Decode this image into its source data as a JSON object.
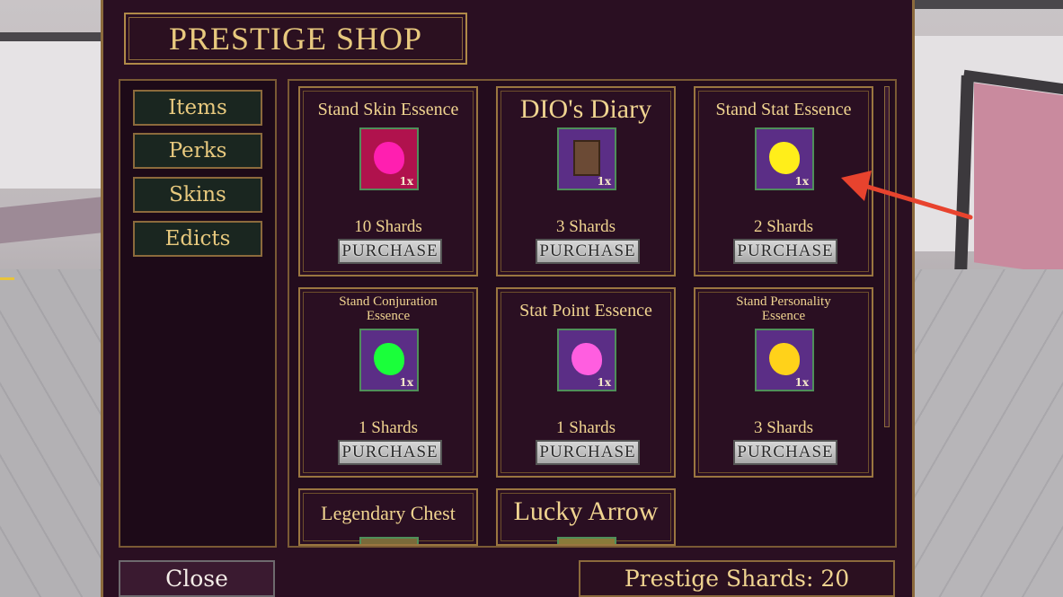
{
  "title": "PRESTIGE SHOP",
  "sidebar": {
    "items": [
      {
        "label": "Items"
      },
      {
        "label": "Perks"
      },
      {
        "label": "Skins"
      },
      {
        "label": "Edicts"
      }
    ]
  },
  "items": [
    {
      "name": "Stand Skin Essence",
      "qty": "1x",
      "price": "10 Shards",
      "button": "PURCHASE",
      "icon": "pink-essence-icon",
      "color": "#ff1fb0"
    },
    {
      "name": "DIO's Diary",
      "qty": "1x",
      "price": "3 Shards",
      "button": "PURCHASE",
      "icon": "diary-book-icon",
      "color": "#6b4a35"
    },
    {
      "name": "Stand Stat Essence",
      "qty": "1x",
      "price": "2 Shards",
      "button": "PURCHASE",
      "icon": "yellow-essence-icon",
      "color": "#ffee1a"
    },
    {
      "name": "Stand Conjuration Essence",
      "qty": "1x",
      "price": "1 Shards",
      "button": "PURCHASE",
      "icon": "green-essence-icon",
      "color": "#1aff3a"
    },
    {
      "name": "Stat Point Essence",
      "qty": "1x",
      "price": "1 Shards",
      "button": "PURCHASE",
      "icon": "pink-essence-icon",
      "color": "#ff5ee0"
    },
    {
      "name": "Stand Personality Essence",
      "qty": "1x",
      "price": "3 Shards",
      "button": "PURCHASE",
      "icon": "gold-essence-icon",
      "color": "#ffd21a"
    },
    {
      "name": "Legendary Chest"
    },
    {
      "name": "Lucky Arrow"
    }
  ],
  "footer": {
    "close_label": "Close",
    "shards_label": "Prestige Shards: 20"
  },
  "colors": {
    "accent_gold": "#e8c97e",
    "panel": "#2a0f22",
    "annotation_arrow": "#e8432e"
  }
}
